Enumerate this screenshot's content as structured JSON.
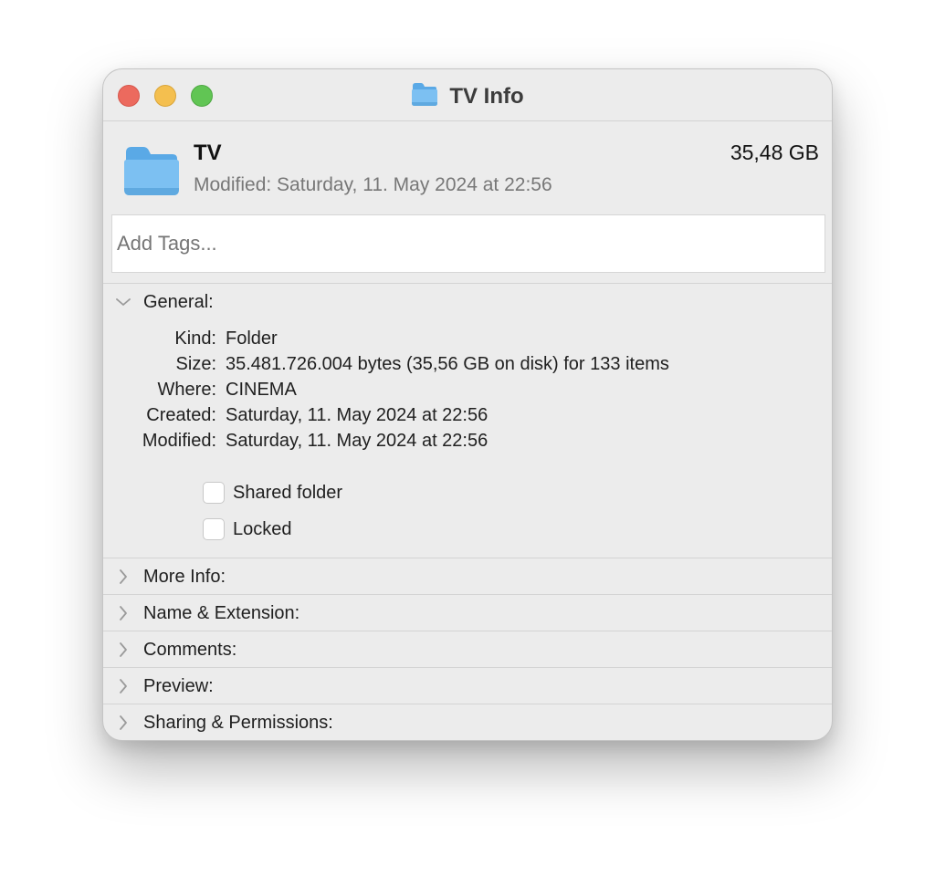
{
  "window": {
    "title": "TV Info",
    "title_icon": "folder-icon"
  },
  "header": {
    "name": "TV",
    "modified": "Modified: Saturday, 11. May 2024 at 22:56",
    "size": "35,48 GB",
    "icon": "folder-icon"
  },
  "tags": {
    "placeholder": "Add Tags...",
    "value": ""
  },
  "general": {
    "label": "General:",
    "expanded": true,
    "rows": [
      {
        "key": "Kind:",
        "value": "Folder"
      },
      {
        "key": "Size:",
        "value": "35.481.726.004 bytes (35,56 GB on disk) for 133 items"
      },
      {
        "key": "Where:",
        "value": "CINEMA"
      },
      {
        "key": "Created:",
        "value": "Saturday, 11. May 2024 at 22:56"
      },
      {
        "key": "Modified:",
        "value": "Saturday, 11. May 2024 at 22:56"
      }
    ],
    "checkboxes": [
      {
        "label": "Shared folder",
        "checked": false
      },
      {
        "label": "Locked",
        "checked": false
      }
    ]
  },
  "sections": [
    {
      "label": "More Info:",
      "expanded": false
    },
    {
      "label": "Name & Extension:",
      "expanded": false
    },
    {
      "label": "Comments:",
      "expanded": false
    },
    {
      "label": "Preview:",
      "expanded": false
    },
    {
      "label": "Sharing & Permissions:",
      "expanded": false
    }
  ],
  "colors": {
    "close": "#ec6a5e",
    "minimize": "#f4bf4f",
    "zoom": "#61c554",
    "folder": "#7cc0f2"
  }
}
